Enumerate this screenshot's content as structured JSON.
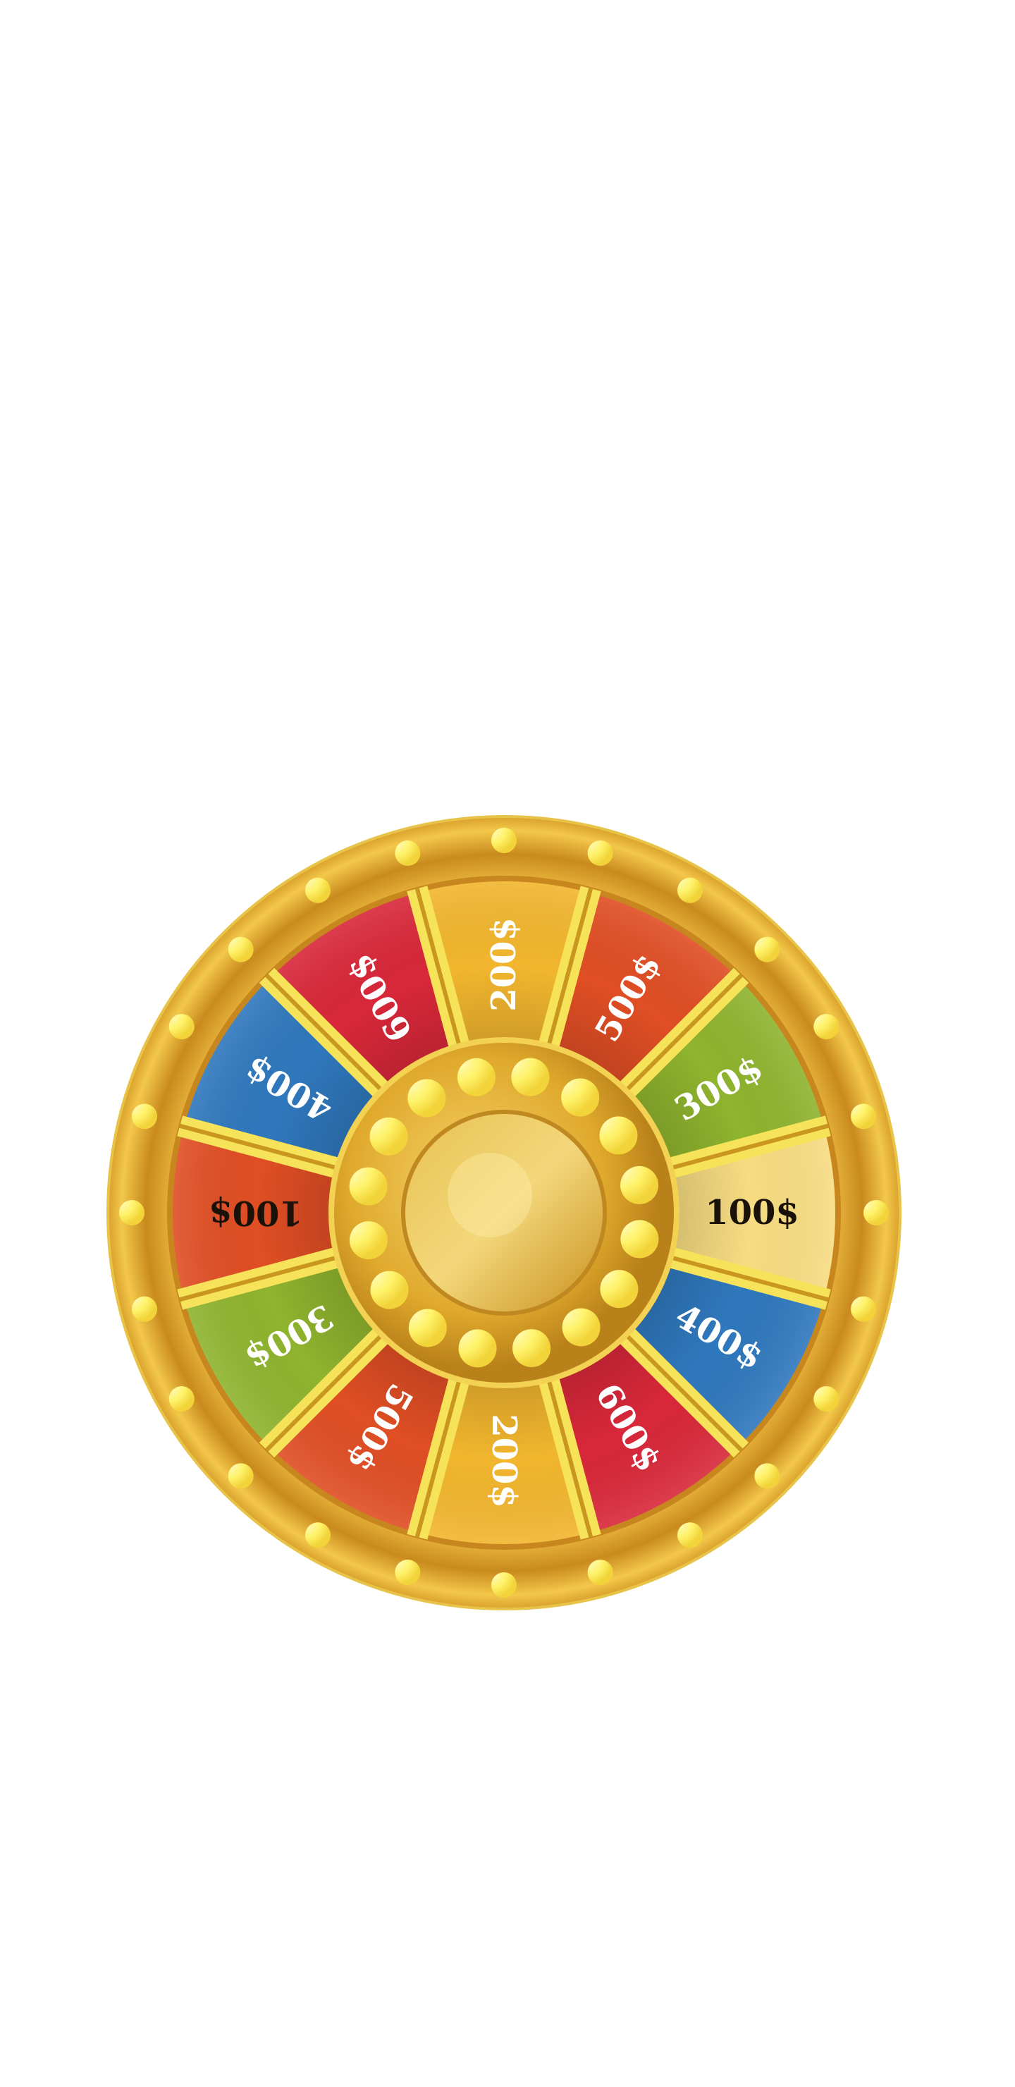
{
  "wheel": {
    "segments": [
      {
        "label": "100$",
        "color": "#f7dc82",
        "text_color": "#1a1208"
      },
      {
        "label": "400$",
        "color": "#2f78bd",
        "text_color": "#ffffff"
      },
      {
        "label": "600$",
        "color": "#d8283a",
        "text_color": "#ffffff"
      },
      {
        "label": "200$",
        "color": "#f2b62e",
        "text_color": "#ffffff"
      },
      {
        "label": "500$",
        "color": "#e04e24",
        "text_color": "#ffffff"
      },
      {
        "label": "300$",
        "color": "#8fb42e",
        "text_color": "#ffffff"
      },
      {
        "label": "100$",
        "color": "#e04e24",
        "text_color": "#1a1208"
      },
      {
        "label": "400$",
        "color": "#2f78bd",
        "text_color": "#ffffff"
      },
      {
        "label": "600$",
        "color": "#d8283a",
        "text_color": "#ffffff"
      },
      {
        "label": "200$",
        "color": "#f2b62e",
        "text_color": "#ffffff"
      },
      {
        "label": "500$",
        "color": "#e04e24",
        "text_color": "#ffffff"
      },
      {
        "label": "300$",
        "color": "#8fb42e",
        "text_color": "#ffffff"
      }
    ],
    "colors": {
      "rim": "#e9b232",
      "rim_dark": "#c7861c",
      "divider": "#f6e35a",
      "bulb": "#fff36b",
      "hub": "#e2ad2f",
      "hub_center": "#d9a42a"
    }
  }
}
